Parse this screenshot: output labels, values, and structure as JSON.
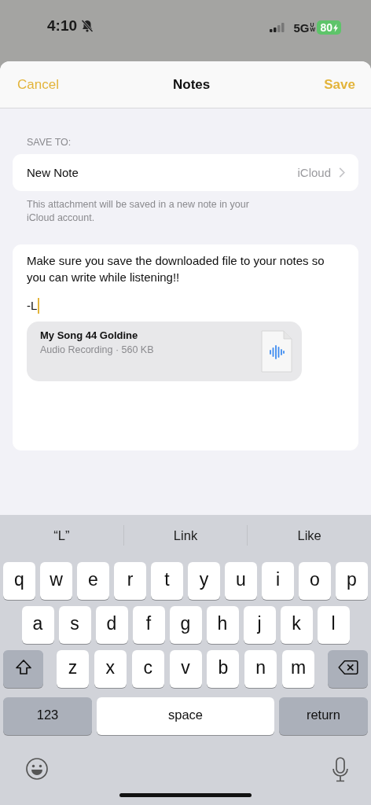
{
  "status_bar": {
    "time": "4:10",
    "silent": true,
    "network": "5G",
    "network_badge": "UW",
    "battery": "80",
    "charging": true
  },
  "header": {
    "cancel": "Cancel",
    "title": "Notes",
    "save": "Save"
  },
  "save_to": {
    "label": "SAVE TO:",
    "destination": "New Note",
    "account": "iCloud",
    "footnote": "This attachment will be saved in a new note in your iCloud account."
  },
  "note": {
    "body": "Make sure you save the downloaded file to your notes so you can write while listening!!",
    "signature": "-L",
    "attachment": {
      "title": "My Song 44 Goldine",
      "subtitle": "Audio Recording · 560 KB"
    }
  },
  "suggestions": [
    "“L”",
    "Link",
    "Like"
  ],
  "keyboard": {
    "rows": [
      [
        {
          "kind": "letter",
          "label": "q"
        },
        {
          "kind": "letter",
          "label": "w"
        },
        {
          "kind": "letter",
          "label": "e"
        },
        {
          "kind": "letter",
          "label": "r"
        },
        {
          "kind": "letter",
          "label": "t"
        },
        {
          "kind": "letter",
          "label": "y"
        },
        {
          "kind": "letter",
          "label": "u"
        },
        {
          "kind": "letter",
          "label": "i"
        },
        {
          "kind": "letter",
          "label": "o"
        },
        {
          "kind": "letter",
          "label": "p"
        }
      ],
      [
        {
          "kind": "letter",
          "label": "a"
        },
        {
          "kind": "letter",
          "label": "s"
        },
        {
          "kind": "letter",
          "label": "d"
        },
        {
          "kind": "letter",
          "label": "f"
        },
        {
          "kind": "letter",
          "label": "g"
        },
        {
          "kind": "letter",
          "label": "h"
        },
        {
          "kind": "letter",
          "label": "j"
        },
        {
          "kind": "letter",
          "label": "k"
        },
        {
          "kind": "letter",
          "label": "l"
        }
      ],
      [
        {
          "kind": "shift"
        },
        {
          "kind": "letter",
          "label": "z"
        },
        {
          "kind": "letter",
          "label": "x"
        },
        {
          "kind": "letter",
          "label": "c"
        },
        {
          "kind": "letter",
          "label": "v"
        },
        {
          "kind": "letter",
          "label": "b"
        },
        {
          "kind": "letter",
          "label": "n"
        },
        {
          "kind": "letter",
          "label": "m"
        },
        {
          "kind": "delete"
        }
      ]
    ],
    "bottom_keys": {
      "numbers": "123",
      "space": "space",
      "return": "return"
    }
  }
}
